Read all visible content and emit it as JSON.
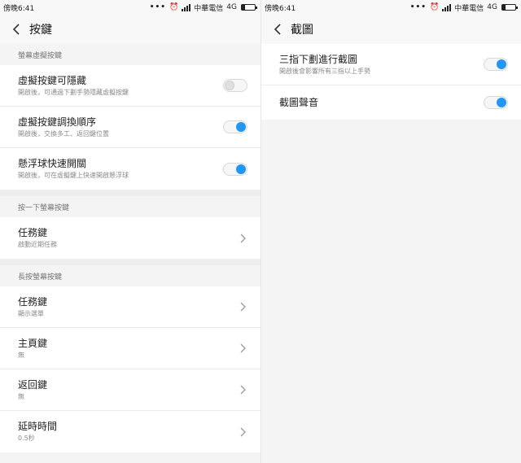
{
  "status_bar": {
    "time": "傍晚6:41",
    "dots": "•••",
    "carrier": "中華電信",
    "network": "4G"
  },
  "left": {
    "title": "按鍵",
    "sections": [
      {
        "header": "螢幕虛擬按鍵",
        "rows": [
          {
            "title": "虛擬按鍵可隱藏",
            "sub": "開啟後，可通過下劃手勢隱藏虛擬按鍵",
            "control": "toggle",
            "state": "off"
          },
          {
            "title": "虛擬按鍵調換順序",
            "sub": "開啟後，交換多工、返回鍵位置",
            "control": "toggle",
            "state": "on"
          },
          {
            "title": "懸浮球快速開關",
            "sub": "開啟後，可在虛擬鍵上快速開啟懸浮球",
            "control": "toggle",
            "state": "on"
          }
        ]
      },
      {
        "header": "按一下螢幕按鍵",
        "rows": [
          {
            "title": "任務鍵",
            "sub": "啟動近期任務",
            "control": "chevron"
          }
        ]
      },
      {
        "header": "長按螢幕按鍵",
        "rows": [
          {
            "title": "任務鍵",
            "sub": "顯示選單",
            "control": "chevron"
          },
          {
            "title": "主頁鍵",
            "sub": "無",
            "control": "chevron"
          },
          {
            "title": "返回鍵",
            "sub": "無",
            "control": "chevron"
          },
          {
            "title": "延時時間",
            "sub": "0.5秒",
            "control": "chevron"
          }
        ]
      }
    ]
  },
  "right": {
    "title": "截圖",
    "rows": [
      {
        "title": "三指下劃進行截圖",
        "sub": "開啟後會影響所有三指以上手勢",
        "control": "toggle",
        "state": "on"
      },
      {
        "title": "截圖聲音",
        "sub": "",
        "control": "toggle",
        "state": "on"
      }
    ]
  },
  "colors": {
    "accent": "#2196f3",
    "background": "#f4f4f4",
    "card": "#ffffff"
  }
}
